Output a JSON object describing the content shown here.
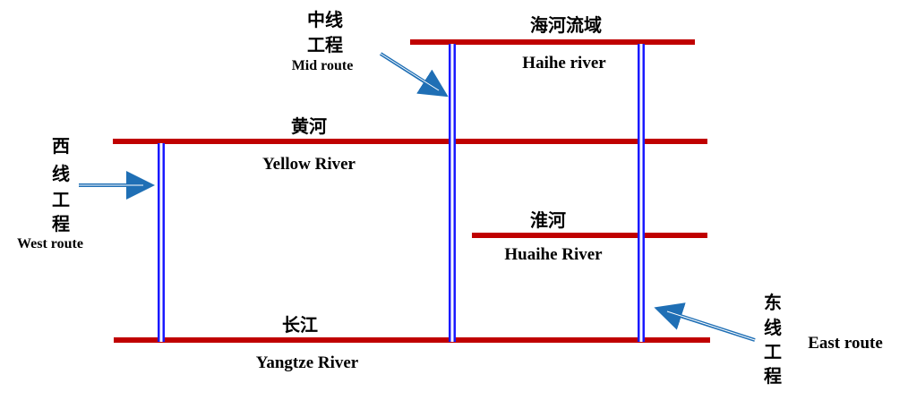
{
  "colors": {
    "river": "#c00000",
    "route": "#1a1aff",
    "arrow": "#1f6fb5"
  },
  "rivers": {
    "haihe": {
      "zh": "海河流域",
      "en": "Haihe river"
    },
    "yellow": {
      "zh": "黄河",
      "en": "Yellow River"
    },
    "huaihe": {
      "zh": "淮河",
      "en": "Huaihe River"
    },
    "yangtze": {
      "zh": "长江",
      "en": "Yangtze River"
    }
  },
  "routes": {
    "mid": {
      "zh_line1": "中线",
      "zh_line2": "工程",
      "en": "Mid route"
    },
    "west": {
      "zh_chars": [
        "西",
        "线",
        "工",
        "程"
      ],
      "en": "West route"
    },
    "east": {
      "zh_chars": [
        "东",
        "线",
        "工",
        "程"
      ],
      "en": "East route"
    }
  }
}
